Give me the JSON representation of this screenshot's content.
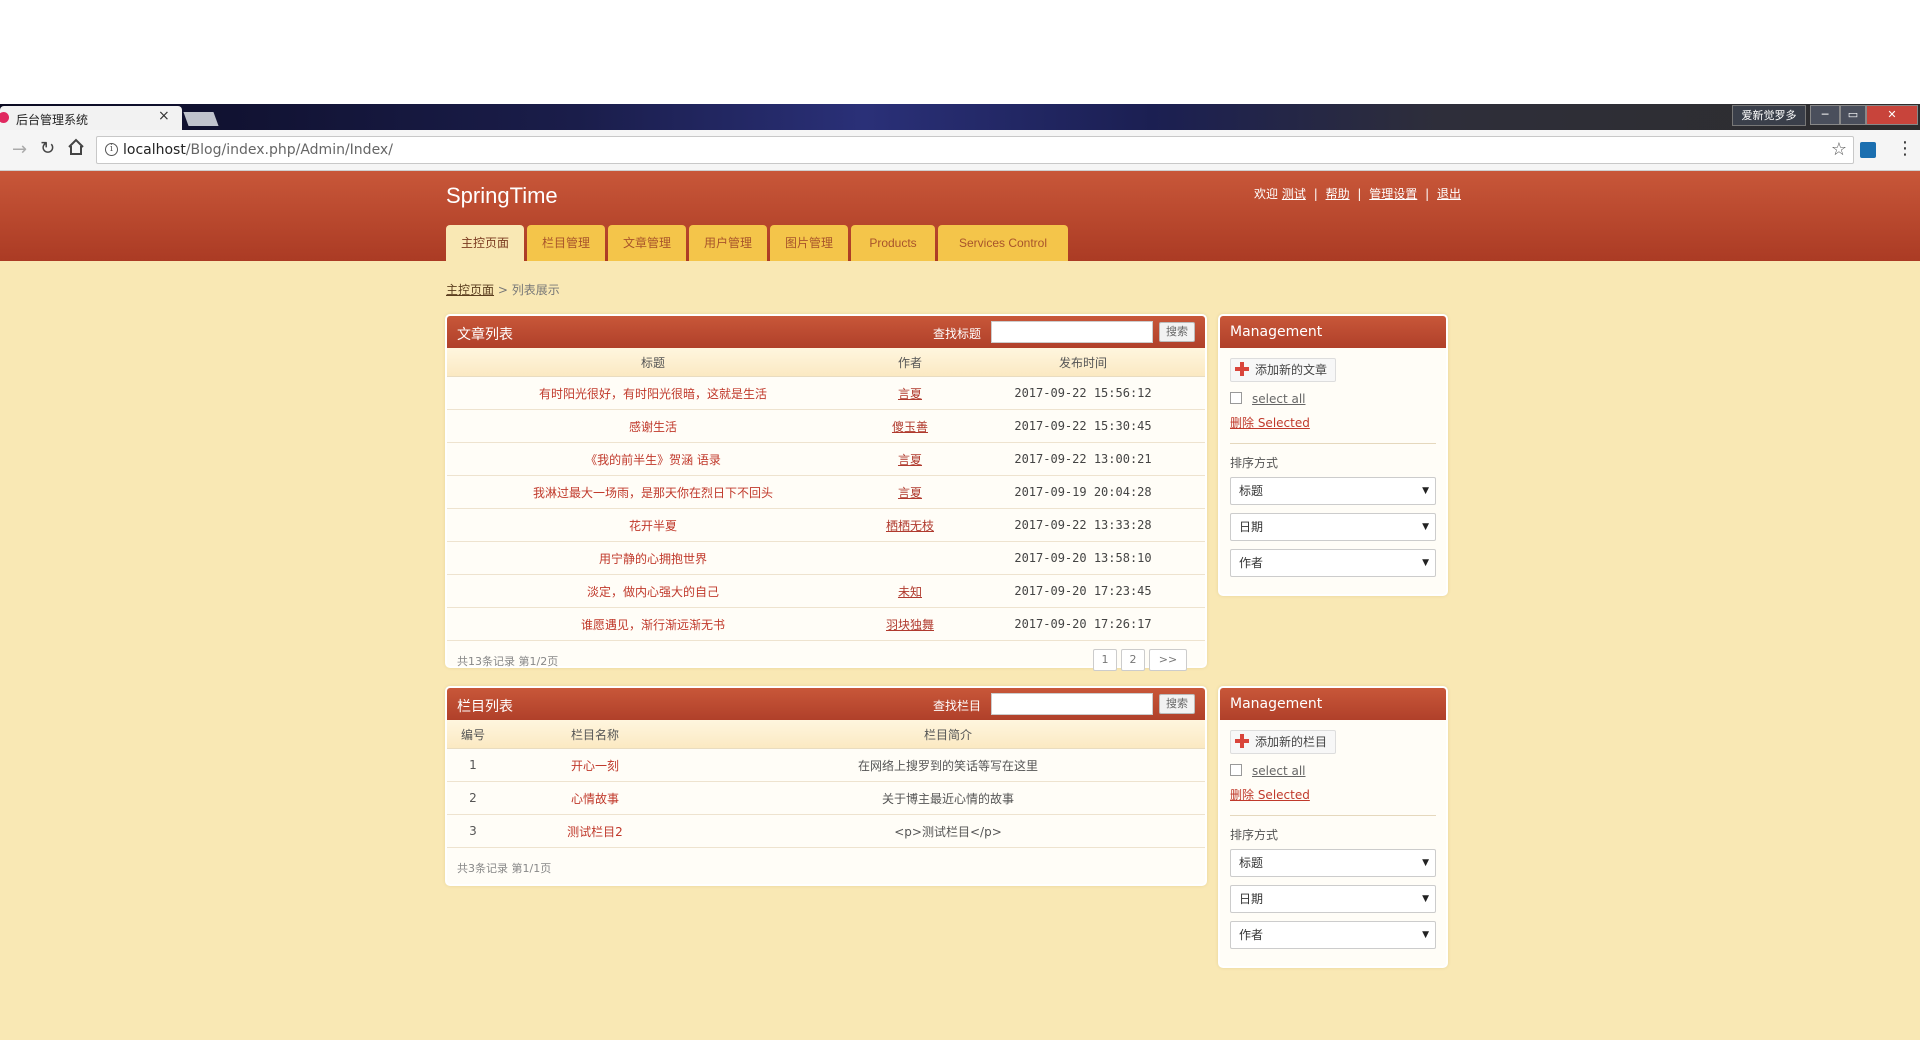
{
  "browser": {
    "tab_title": "后台管理系统",
    "tab_close": "×",
    "user_button": "爱新觉罗多",
    "win_min": "─",
    "win_max": "▭",
    "win_close": "✕",
    "url_host": "localhost",
    "url_path": "/Blog/index.php/Admin/Index/",
    "icons": [
      "back-icon",
      "reload-icon",
      "home-icon",
      "info-icon",
      "star-icon",
      "extension-icon",
      "menu-icon"
    ]
  },
  "header": {
    "brand": "SpringTime",
    "welcome": "欢迎",
    "user": "测试",
    "help": "帮助",
    "settings": "管理设置",
    "logout": "退出",
    "sep": "|"
  },
  "nav": {
    "tabs": [
      {
        "label": "主控页面",
        "active": true
      },
      {
        "label": "栏目管理"
      },
      {
        "label": "文章管理"
      },
      {
        "label": "用户管理"
      },
      {
        "label": "图片管理"
      },
      {
        "label": "Products"
      },
      {
        "label": "Services Control"
      }
    ]
  },
  "breadcrumb": {
    "home": "主控页面",
    "sep": ">",
    "current": "列表展示"
  },
  "articles": {
    "title": "文章列表",
    "search_label": "查找标题",
    "search_button": "搜索",
    "columns": [
      "标题",
      "作者",
      "发布时间"
    ],
    "rows": [
      {
        "title": "有时阳光很好，有时阳光很暗，这就是生活",
        "author": "言夏",
        "date": "2017-09-22 15:56:12"
      },
      {
        "title": "感谢生活",
        "author": "傻玉善",
        "date": "2017-09-22 15:30:45"
      },
      {
        "title": "《我的前半生》贺涵 语录",
        "author": "言夏",
        "date": "2017-09-22 13:00:21"
      },
      {
        "title": "我淋过最大一场雨，是那天你在烈日下不回头",
        "author": "言夏",
        "date": "2017-09-19 20:04:28"
      },
      {
        "title": "花开半夏",
        "author": "栖栖无枝",
        "date": "2017-09-22 13:33:28"
      },
      {
        "title": "用宁静的心拥抱世界",
        "author": "",
        "date": "2017-09-20 13:58:10"
      },
      {
        "title": "淡定，做内心强大的自己",
        "author": "未知",
        "date": "2017-09-20 17:23:45"
      },
      {
        "title": "谁愿遇见，渐行渐远渐无书",
        "author": "羽块独舞",
        "date": "2017-09-20 17:26:17"
      }
    ],
    "records": "共13条记录 第1/2页",
    "pages": [
      "1",
      "2",
      ">>"
    ]
  },
  "categories": {
    "title": "栏目列表",
    "search_label": "查找栏目",
    "search_button": "搜索",
    "columns": [
      "编号",
      "栏目名称",
      "栏目简介"
    ],
    "rows": [
      {
        "id": "1",
        "name": "开心一刻",
        "desc": "在网络上搜罗到的笑话等写在这里"
      },
      {
        "id": "2",
        "name": "心情故事",
        "desc": "关于博主最近心情的故事"
      },
      {
        "id": "3",
        "name": "测试栏目2",
        "desc": "<p>测试栏目</p>"
      }
    ],
    "records": "共3条记录 第1/1页"
  },
  "side1": {
    "title": "Management",
    "add_label": "添加新的文章",
    "select_all": "select all",
    "delete_selected": "删除 Selected",
    "sort_label": "排序方式",
    "selects": [
      "标题",
      "日期",
      "作者"
    ]
  },
  "side2": {
    "title": "Management",
    "add_label": "添加新的栏目",
    "select_all": "select all",
    "delete_selected": "删除 Selected",
    "sort_label": "排序方式",
    "selects": [
      "标题",
      "日期",
      "作者"
    ]
  },
  "colors": {
    "header": "#b8452b",
    "nav_tab": "#f4c54a",
    "page_bg": "#f9e8b4",
    "link_red": "#c0392b"
  }
}
